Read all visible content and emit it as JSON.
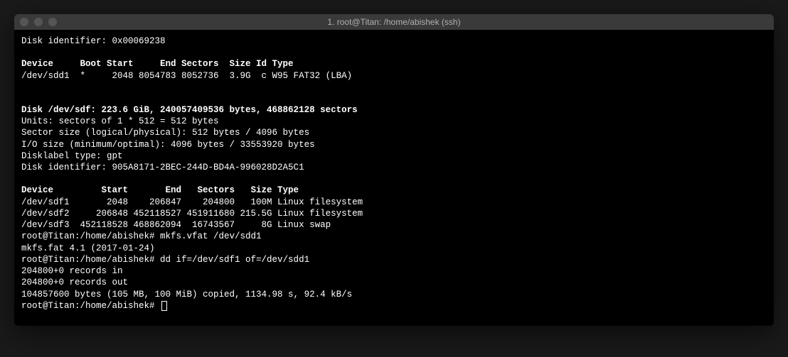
{
  "window": {
    "title": "1. root@Titan: /home/abishek (ssh)"
  },
  "terminal": {
    "lines": [
      {
        "text": "Disk identifier: 0x00069238",
        "bold": false
      },
      {
        "text": "",
        "bold": false
      },
      {
        "text": "Device     Boot Start     End Sectors  Size Id Type",
        "bold": true
      },
      {
        "text": "/dev/sdd1  *     2048 8054783 8052736  3.9G  c W95 FAT32 (LBA)",
        "bold": false
      },
      {
        "text": "",
        "bold": false
      },
      {
        "text": "",
        "bold": false
      },
      {
        "text": "Disk /dev/sdf: 223.6 GiB, 240057409536 bytes, 468862128 sectors",
        "bold": true
      },
      {
        "text": "Units: sectors of 1 * 512 = 512 bytes",
        "bold": false
      },
      {
        "text": "Sector size (logical/physical): 512 bytes / 4096 bytes",
        "bold": false
      },
      {
        "text": "I/O size (minimum/optimal): 4096 bytes / 33553920 bytes",
        "bold": false
      },
      {
        "text": "Disklabel type: gpt",
        "bold": false
      },
      {
        "text": "Disk identifier: 905A8171-2BEC-244D-BD4A-996028D2A5C1",
        "bold": false
      },
      {
        "text": "",
        "bold": false
      },
      {
        "text": "Device         Start       End   Sectors   Size Type",
        "bold": true
      },
      {
        "text": "/dev/sdf1       2048    206847    204800   100M Linux filesystem",
        "bold": false
      },
      {
        "text": "/dev/sdf2     206848 452118527 451911680 215.5G Linux filesystem",
        "bold": false
      },
      {
        "text": "/dev/sdf3  452118528 468862094  16743567     8G Linux swap",
        "bold": false
      },
      {
        "text": "root@Titan:/home/abishek# mkfs.vfat /dev/sdd1",
        "bold": false
      },
      {
        "text": "mkfs.fat 4.1 (2017-01-24)",
        "bold": false
      },
      {
        "text": "root@Titan:/home/abishek# dd if=/dev/sdf1 of=/dev/sdd1",
        "bold": false
      },
      {
        "text": "204800+0 records in",
        "bold": false
      },
      {
        "text": "204800+0 records out",
        "bold": false
      },
      {
        "text": "104857600 bytes (105 MB, 100 MiB) copied, 1134.98 s, 92.4 kB/s",
        "bold": false
      }
    ],
    "prompt": "root@Titan:/home/abishek# "
  }
}
